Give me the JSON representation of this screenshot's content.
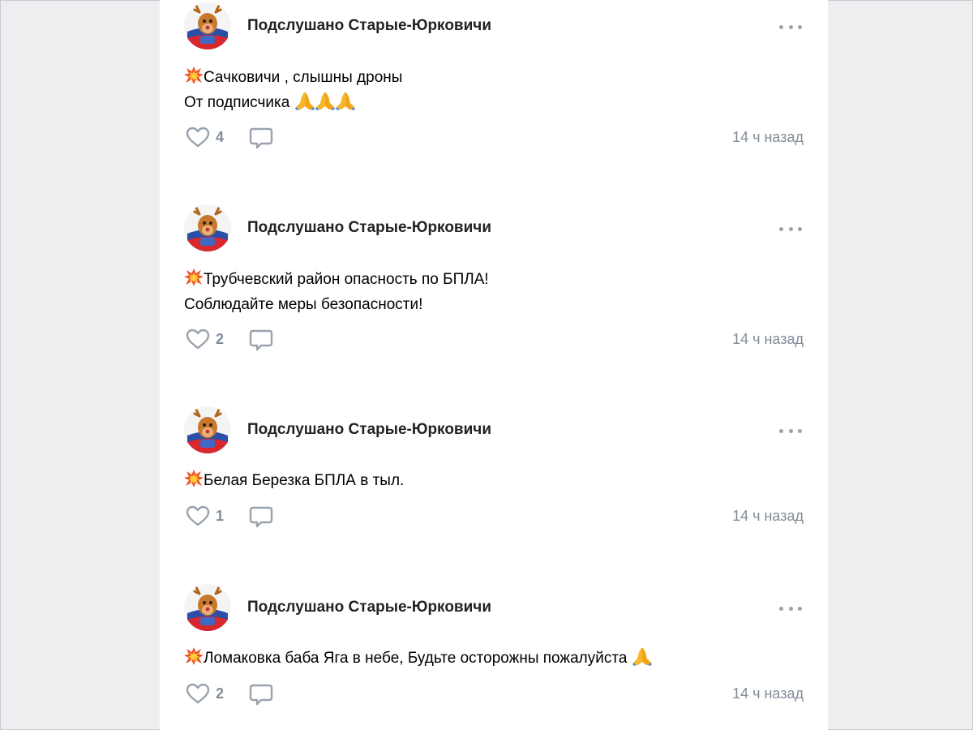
{
  "posts": [
    {
      "author": "Подслушано Старые-Юрковичи",
      "lines": [
        "Сачковичи , слышны дроны",
        "От подписчика"
      ],
      "likes": "4",
      "time": "14 ч назад"
    },
    {
      "author": "Подслушано Старые-Юрковичи",
      "lines": [
        "Трубчевский район опасность по БПЛА!",
        "Соблюдайте меры безопасности!"
      ],
      "likes": "2",
      "time": "14 ч назад"
    },
    {
      "author": "Подслушано Старые-Юрковичи",
      "lines": [
        "Белая Березка БПЛА в тыл."
      ],
      "likes": "1",
      "time": "14 ч назад"
    },
    {
      "author": "Подслушано Старые-Юрковичи",
      "lines": [
        "Ломаковка баба Яга в небе, Будьте осторожны пожалуйста"
      ],
      "likes": "2",
      "time": "14 ч назад"
    }
  ],
  "icons": {
    "post_marker": "collision-emoji",
    "praying_hands": "folded-hands-emoji",
    "like": "heart-outline-icon",
    "comment": "comment-bubble-icon",
    "more": "more-horizontal-icon"
  },
  "colors": {
    "page_background": "#edeef0",
    "card_background": "#ffffff",
    "secondary_text": "#818c99",
    "icon": "#99a2ad"
  }
}
